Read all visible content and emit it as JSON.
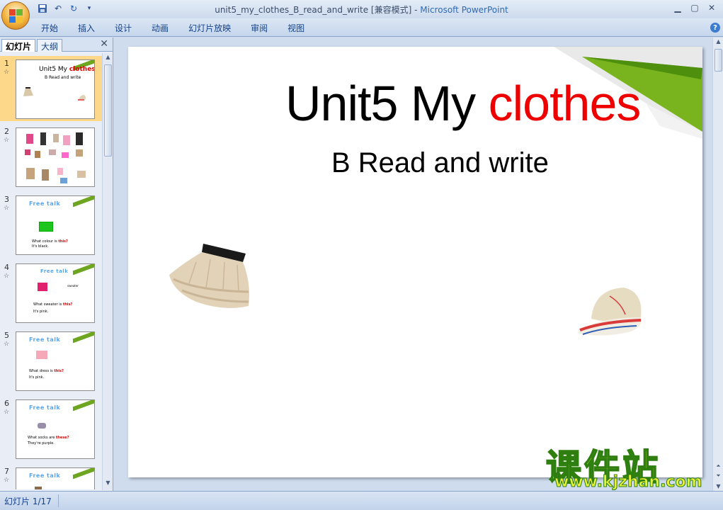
{
  "window": {
    "title": "unit5_my_clothes_B_read_and_write [兼容模式] - ",
    "app_name": "Microsoft PowerPoint"
  },
  "ribbon": {
    "tabs": [
      "开始",
      "插入",
      "设计",
      "动画",
      "幻灯片放映",
      "审阅",
      "视图"
    ]
  },
  "panel": {
    "tab_slides": "幻灯片",
    "tab_outline": "大纲",
    "close": "✕"
  },
  "thumbnails": [
    {
      "num": "1",
      "title_a": "Unit5 My ",
      "title_b": "clothes",
      "sub": "B Read and write"
    },
    {
      "num": "2"
    },
    {
      "num": "3",
      "heading": "Free  talk",
      "line1a": "What colour  is  ",
      "line1b": "this?",
      "line2": "It's black."
    },
    {
      "num": "4",
      "heading": "Free talk",
      "line1a": "What sweater  is  ",
      "line1b": "this?",
      "line2": "It's pink.",
      "side": "sweater"
    },
    {
      "num": "5",
      "heading": "Free  talk",
      "line1a": "What dress  is  ",
      "line1b": "this?",
      "line2": "It's pink."
    },
    {
      "num": "6",
      "heading": "Free  talk",
      "line1a": "What socks  are  ",
      "line1b": "these?",
      "line2": "They're purple."
    },
    {
      "num": "7",
      "heading": "Free  talk"
    }
  ],
  "slide": {
    "title_main": "Unit5 My ",
    "title_accent": "clothes",
    "subtitle": "B Read and write",
    "accent_color": "#e00000",
    "corner_color": "#6ea61f"
  },
  "watermark": {
    "cn": "课件站",
    "url": "www.kjzhan.com"
  },
  "status": {
    "slide_indicator": "幻灯片 1/17"
  },
  "icons": [
    "office-button-icon",
    "save-icon",
    "undo-icon",
    "redo-icon",
    "customize-qat-icon",
    "minimize-icon",
    "maximize-icon",
    "close-icon",
    "help-icon",
    "star-icon"
  ]
}
